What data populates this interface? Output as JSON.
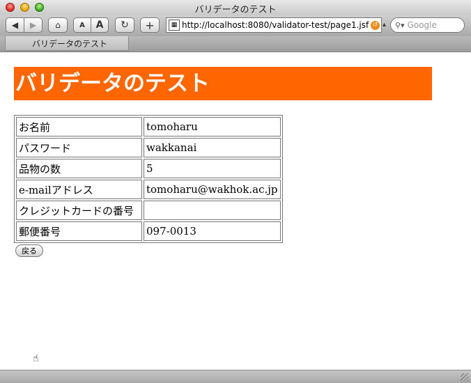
{
  "window": {
    "title": "バリデータのテスト"
  },
  "toolbar": {
    "back_icon": "◀",
    "forward_icon": "▶",
    "home_icon": "⌂",
    "text_smaller": "A",
    "text_bigger": "A",
    "reload_icon": "↻",
    "add_bookmark_icon": "+",
    "address": "http://localhost:8080/validator-test/page1.jsf",
    "search_placeholder": "Google"
  },
  "tabs": [
    {
      "label": "バリデータのテスト"
    }
  ],
  "page": {
    "heading": "バリデータのテスト",
    "rows": [
      {
        "label": "お名前",
        "value": "tomoharu"
      },
      {
        "label": "パスワード",
        "value": "wakkanai"
      },
      {
        "label": "品物の数",
        "value": "5"
      },
      {
        "label": "e-mailアドレス",
        "value": "tomoharu@wakhok.ac.jp"
      },
      {
        "label": "クレジットカードの番号",
        "value": ""
      },
      {
        "label": "郵便番号",
        "value": "097-0013"
      }
    ],
    "back_button": "戻る"
  },
  "colors": {
    "heading_bg": "#ff6600",
    "heading_text": "#ffffff"
  }
}
